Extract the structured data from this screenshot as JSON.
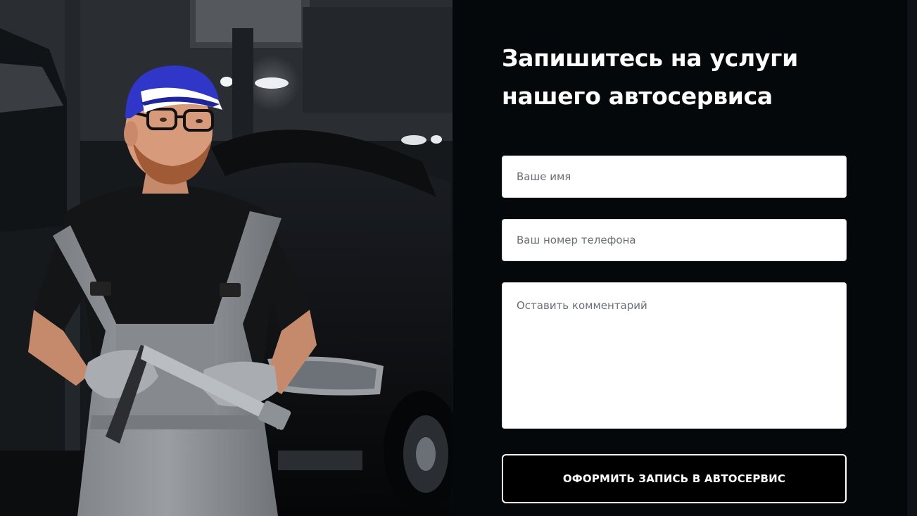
{
  "hero_image": {
    "icon": "mechanic-photo"
  },
  "form": {
    "title_line1": "Запишитесь на услуги",
    "title_line2": "нашего автосервиса",
    "name_placeholder": "Ваше имя",
    "phone_placeholder": "Ваш номер телефона",
    "comment_placeholder": "Оставить комментарий",
    "submit_label": "ОФОРМИТЬ ЗАПИСЬ В АВТОСЕРВИС"
  },
  "colors": {
    "background": "#04080b",
    "text": "#ffffff",
    "field_bg": "#ffffff",
    "button_bg": "#000000",
    "button_border": "#ffffff",
    "cap": "#2f36c8",
    "overalls": "#8e9296"
  }
}
